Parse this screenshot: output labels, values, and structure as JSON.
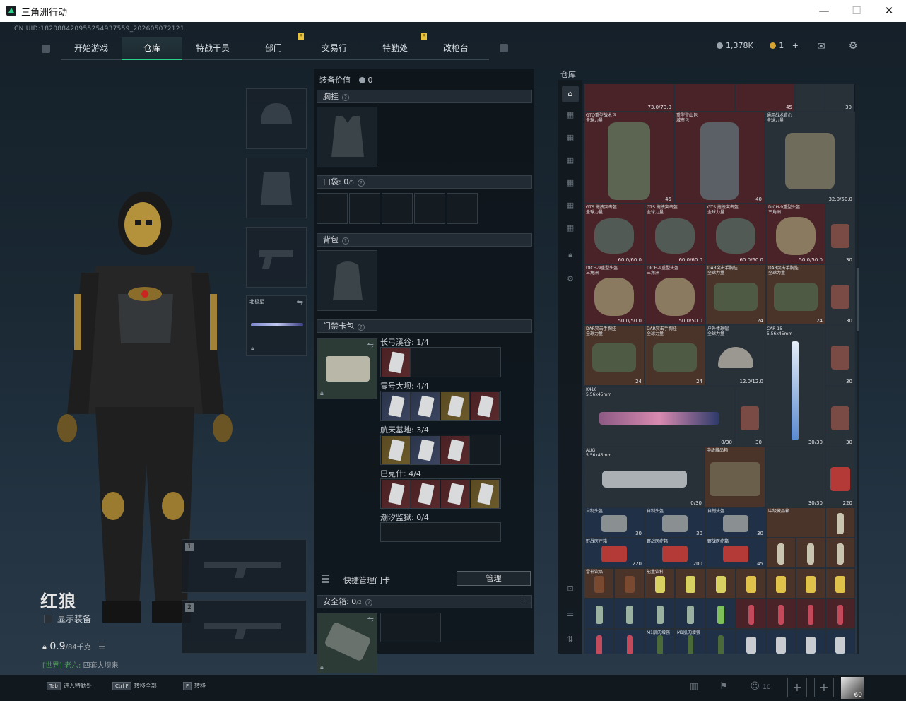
{
  "window": {
    "title": "三角洲行动",
    "minimize": "—",
    "maximize": "☐",
    "close": "✕"
  },
  "uid": "CN UID:18208842095525493755​9_202605072121",
  "nav": {
    "tabs": [
      "开始游戏",
      "仓库",
      "特战干员",
      "部门",
      "交易行",
      "特勤处",
      "改枪台"
    ],
    "active": "仓库",
    "badge": "!"
  },
  "currency": {
    "coins": "1,378K",
    "gold": "1",
    "plus": "+"
  },
  "character": {
    "name": "红狼",
    "show_equipment": "显示装备",
    "weight": "0.9",
    "weight_max": "/84千克",
    "world_tag": "[世界]",
    "world_user": "老六:",
    "world_msg": "四套大坝来"
  },
  "gear": {
    "knife_label": "北极星"
  },
  "middle": {
    "equip_value_label": "装备价值",
    "equip_value": "0",
    "chest_label": "胸挂",
    "pocket_label": "口袋:",
    "pocket_count": "0",
    "pocket_max": "/5",
    "backpack_label": "背包",
    "keycard_label": "门禁卡包",
    "keycard_groups": [
      {
        "name": "长弓溪谷: 1/4"
      },
      {
        "name": "零号大坝: 4/4"
      },
      {
        "name": "航天基地: 3/4"
      },
      {
        "name": "巴克什: 4/4"
      },
      {
        "name": "潮汐监狱: 0/4"
      }
    ],
    "quick_manage": "快捷管理门卡",
    "manage_button": "管理",
    "safe_label": "安全箱:",
    "safe_count": "0",
    "safe_max": "/2"
  },
  "storage": {
    "title": "仓库",
    "items": [
      {
        "name": "GTO重型战术包",
        "sub": "全球力量",
        "count": "",
        "tone": "red"
      },
      {
        "name": "重型登山包",
        "sub": "城市包",
        "count": "",
        "tone": "red"
      },
      {
        "name": "通用战术背心",
        "sub": "全球力量",
        "count": "32.0/50.0",
        "tone": "grey"
      },
      {
        "name": "GTS 拖拽突击盔",
        "sub": "全球力量",
        "count": "60.0/60.0",
        "tone": "red"
      },
      {
        "name": "GTS 拖拽突击盔",
        "sub": "全球力量",
        "count": "60.0/60.0",
        "tone": "red"
      },
      {
        "name": "GTS 拖拽突击盔",
        "sub": "全球力量",
        "count": "60.0/60.0",
        "tone": "red"
      },
      {
        "name": "DICH-9重型头盔",
        "sub": "三角洲",
        "count": "50.0/50.0",
        "tone": "red"
      },
      {
        "name": "DICH-9重型头盔",
        "sub": "三角洲",
        "count": "50.0/50.0",
        "tone": "red"
      },
      {
        "name": "DICH-9重型头盔",
        "sub": "三角洲",
        "count": "50.0/50.0",
        "tone": "red"
      },
      {
        "name": "DAR突击手胸挂",
        "sub": "全球力量",
        "count": "24",
        "tone": "brown"
      },
      {
        "name": "DAR突击手胸挂",
        "sub": "全球力量",
        "count": "24",
        "tone": "brown"
      },
      {
        "name": "户外棒球帽",
        "sub": "全球力量",
        "count": "12.0/12.0",
        "tone": "grey"
      },
      {
        "name": "CAR-15",
        "sub": "5.56x45mm",
        "count": "",
        "tone": "grey"
      },
      {
        "name": "K416",
        "sub": "5.56x45mm",
        "count": "0/30",
        "tone": "grey"
      },
      {
        "name": "AUG",
        "sub": "5.56x45mm",
        "count": "0/30",
        "tone": "grey"
      },
      {
        "name": "中级藏品箱",
        "sub": "",
        "count": "",
        "tone": "brown"
      },
      {
        "name": "中级藏品箱",
        "sub": "",
        "count": "",
        "tone": "brown"
      },
      {
        "name": "自制头盔",
        "sub": "",
        "count": "30",
        "tone": "blue"
      },
      {
        "name": "野战医疗箱",
        "sub": "",
        "count": "220",
        "tone": "blue"
      },
      {
        "name": "雷神饮品",
        "sub": "",
        "count": "",
        "tone": "brown"
      },
      {
        "name": "能量饮料",
        "sub": "",
        "count": "",
        "tone": "brown"
      },
      {
        "name": "M1肌肉增强",
        "sub": "",
        "count": "",
        "tone": "blue"
      }
    ],
    "counts_misc": [
      "73.0/73.0",
      "45",
      "30",
      "40",
      "30/30",
      "200",
      "45"
    ]
  },
  "bottom": {
    "hotkeys": [
      {
        "key": "Tab",
        "label": "进入特勤处"
      },
      {
        "key": "Ctrl F",
        "label": "转移全部"
      },
      {
        "key": "F",
        "label": "转移"
      }
    ],
    "friends": "10",
    "level": "60"
  }
}
